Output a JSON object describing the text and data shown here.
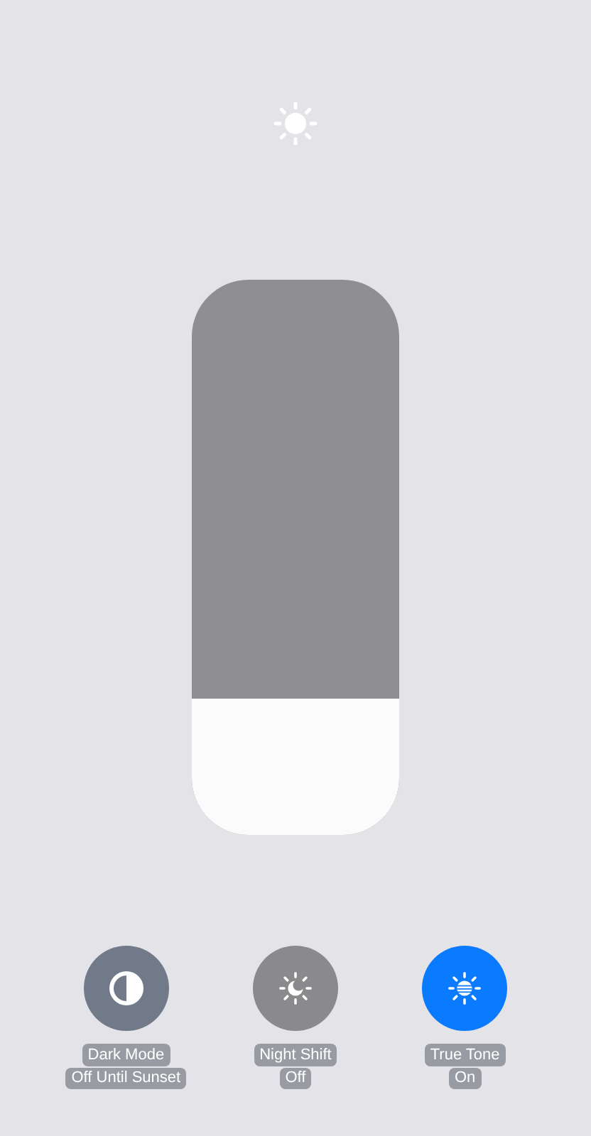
{
  "brightness": {
    "level": 0.245
  },
  "toggles": [
    {
      "kind": "dark-mode",
      "label": "Dark Mode",
      "status": "Off Until Sunset",
      "on": false
    },
    {
      "kind": "night-shift",
      "label": "Night Shift",
      "status": "Off",
      "on": false
    },
    {
      "kind": "true-tone",
      "label": "True Tone",
      "status": "On",
      "on": true
    }
  ]
}
